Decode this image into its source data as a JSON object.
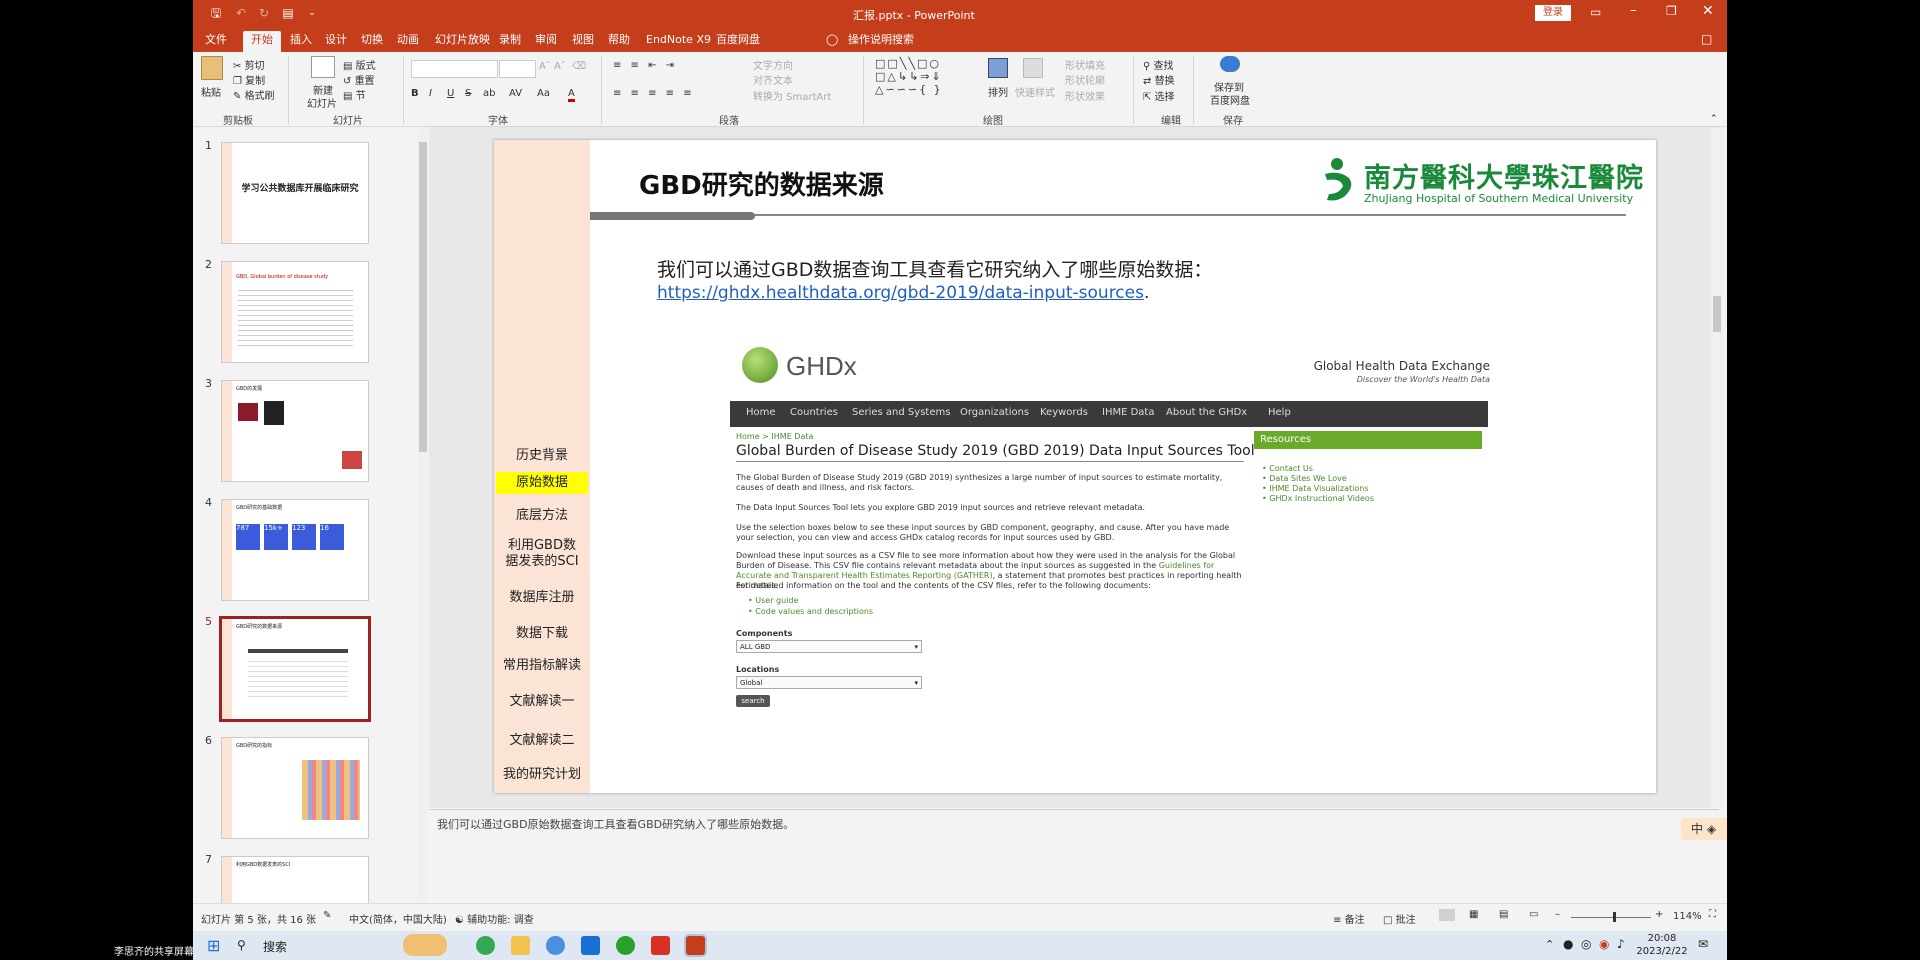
{
  "window": {
    "title": "汇报.pptx - PowerPoint",
    "login": "登录"
  },
  "qat": [
    "save-icon",
    "undo-icon",
    "redo-icon",
    "presentation-icon",
    "customize-icon"
  ],
  "tabs": [
    "文件",
    "开始",
    "插入",
    "设计",
    "切换",
    "动画",
    "幻灯片放映",
    "录制",
    "审阅",
    "视图",
    "帮助",
    "EndNote X9",
    "百度网盘",
    "操作说明搜索"
  ],
  "ribbon": {
    "clipboard": {
      "paste": "粘贴",
      "cut": "剪切",
      "copy": "复制",
      "format": "格式刷",
      "label": "剪贴板"
    },
    "slides": {
      "new": "新建",
      "new2": "幻灯片",
      "layout": "版式",
      "reset": "重置",
      "section": "节",
      "label": "幻灯片"
    },
    "font": {
      "label": "字体",
      "bold": "B",
      "italic": "I",
      "underline": "U",
      "strike": "S",
      "shadow": "ab",
      "spacing": "AV",
      "case": "Aa",
      "fontcolor": "A"
    },
    "paragraph": {
      "label": "段落",
      "direction": "文字方向",
      "align": "对齐文本",
      "smartart": "转换为 SmartArt"
    },
    "drawing": {
      "arrange": "排列",
      "styles": "快速样式",
      "fill": "形状填充",
      "outline": "形状轮廓",
      "effect": "形状效果",
      "label": "绘图"
    },
    "editing": {
      "find": "查找",
      "replace": "替换",
      "select": "选择",
      "label": "编辑"
    },
    "save": {
      "line1": "保存到",
      "line2": "百度网盘",
      "label": "保存"
    }
  },
  "thumbnails": [
    {
      "num": "1",
      "title": "学习公共数据库开展临床研究"
    },
    {
      "num": "2",
      "title": "GBD, Global burden of disease study"
    },
    {
      "num": "3",
      "title": "GBD的发展"
    },
    {
      "num": "4",
      "title": "GBD研究的基础数据",
      "stats": [
        "787",
        "15k+",
        "123",
        "16"
      ]
    },
    {
      "num": "5",
      "title": "GBD研究的数据来源"
    },
    {
      "num": "6",
      "title": "GBD研究的指标"
    },
    {
      "num": "7",
      "title": "利用GBD数据发表的SCI"
    }
  ],
  "slide": {
    "title": "GBD研究的数据来源",
    "logo_cn": "南方醫科大學珠江醫院",
    "logo_en": "ZhuJiang Hospital of Southern Medical University",
    "body": "我们可以通过GBD数据查询工具查看它研究纳入了哪些原始数据：",
    "link": "https://ghdx.healthdata.org/gbd-2019/data-input-sources",
    "link_suffix": ".",
    "nav": [
      "历史背景",
      "原始数据",
      "底层方法",
      "利用GBD数据发表的SCI",
      "数据库注册",
      "数据下载",
      "常用指标解读",
      "文献解读一",
      "文献解读二",
      "我的研究计划"
    ]
  },
  "ghdx": {
    "brand": "GHDx",
    "exchange": "Global Health Data Exchange",
    "tagline": "Discover the World's Health Data",
    "menu": [
      "Home",
      "Countries",
      "Series and Systems",
      "Organizations",
      "Keywords",
      "IHME Data",
      "About the GHDx",
      "Help"
    ],
    "breadcrumb": "Home > IHME Data",
    "heading": "Global Burden of Disease Study 2019 (GBD 2019) Data Input Sources Tool",
    "p1": "The Global Burden of Disease Study 2019 (GBD 2019) synthesizes a large number of input sources to estimate mortality, causes of death and illness, and risk factors.",
    "p2": "The Data Input Sources Tool lets you explore GBD 2019 input sources and retrieve relevant metadata.",
    "p3": "Use the selection boxes below to see these input sources by GBD component, geography, and cause. After you have made your selection, you can view and access GHDx catalog records for input sources used by GBD.",
    "p4a": "Download these input sources as a CSV file to see more information about how they were used in the analysis for the Global Burden of Disease. This CSV file contains relevant metadata about the input sources as suggested in the ",
    "p4link": "Guidelines for Accurate and Transparent Health Estimates Reporting (GATHER)",
    "p4b": ", a statement that promotes best practices in reporting health estimates.",
    "p5": "For detailed information on the tool and the contents of the CSV files, refer to the following documents:",
    "docs": [
      "User guide",
      "Code values and descriptions"
    ],
    "components_label": "Components",
    "components_value": "ALL GBD",
    "locations_label": "Locations",
    "locations_value": "Global",
    "search": "search",
    "resources_title": "Resources",
    "resources": [
      "Contact Us",
      "Data Sites We Love",
      "IHME Data Visualizations",
      "GHDx Instructional Videos"
    ]
  },
  "notes": "我们可以通过GBD原始数据查询工具查看GBD研究纳入了哪些原始数据。",
  "ime": "中",
  "status": {
    "slide": "幻灯片 第 5 张，共 16 张",
    "lang": "中文(简体，中国大陆)",
    "access": "辅助功能: 调查",
    "notes": "备注",
    "comments": "批注",
    "zoom": "114%"
  },
  "taskbar": {
    "search": "搜索",
    "time": "20:08",
    "date": "2023/2/22",
    "share": "李思齐的共享屏幕"
  },
  "colors": {
    "accent": "#c43e1c",
    "nav_bg": "#fbe4d5",
    "nav_active": "#ffff00",
    "ghdx_green": "#6aaa2a",
    "link": "#1f5fbf"
  }
}
